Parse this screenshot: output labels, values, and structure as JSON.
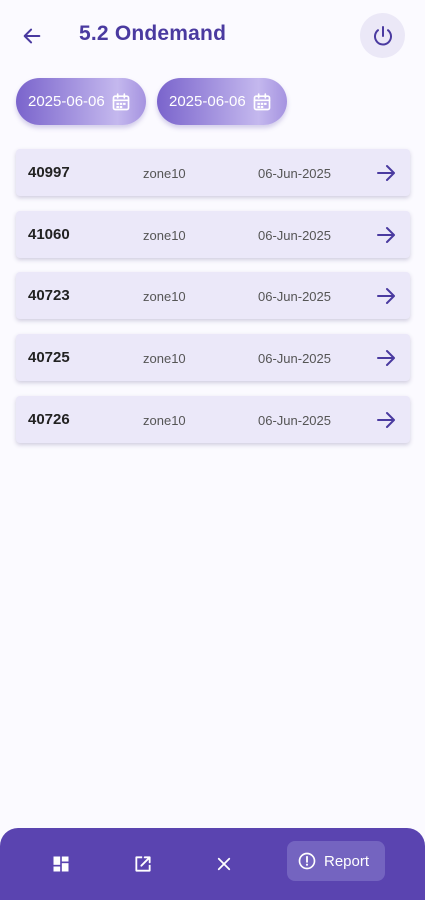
{
  "header": {
    "title": "5.2 Ondemand",
    "back_icon": "arrow-left-icon",
    "power_icon": "power-icon"
  },
  "filters": {
    "from_date": "2025-06-06",
    "to_date": "2025-06-06",
    "calendar_icon": "calendar-icon"
  },
  "items": [
    {
      "id": "40997",
      "zone": "zone10",
      "date": "06-Jun-2025"
    },
    {
      "id": "41060",
      "zone": "zone10",
      "date": "06-Jun-2025"
    },
    {
      "id": "40723",
      "zone": "zone10",
      "date": "06-Jun-2025"
    },
    {
      "id": "40725",
      "zone": "zone10",
      "date": "06-Jun-2025"
    },
    {
      "id": "40726",
      "zone": "zone10",
      "date": "06-Jun-2025"
    }
  ],
  "bottom_bar": {
    "icons": [
      "dashboard-icon",
      "open-external-icon",
      "close-icon"
    ],
    "report_label": "Report",
    "report_icon": "alert-circle-icon"
  },
  "colors": {
    "accent": "#5a44b0",
    "title": "#4a3aa0",
    "row_bg": "#ebe8f9",
    "page_bg": "#fbfaff"
  }
}
